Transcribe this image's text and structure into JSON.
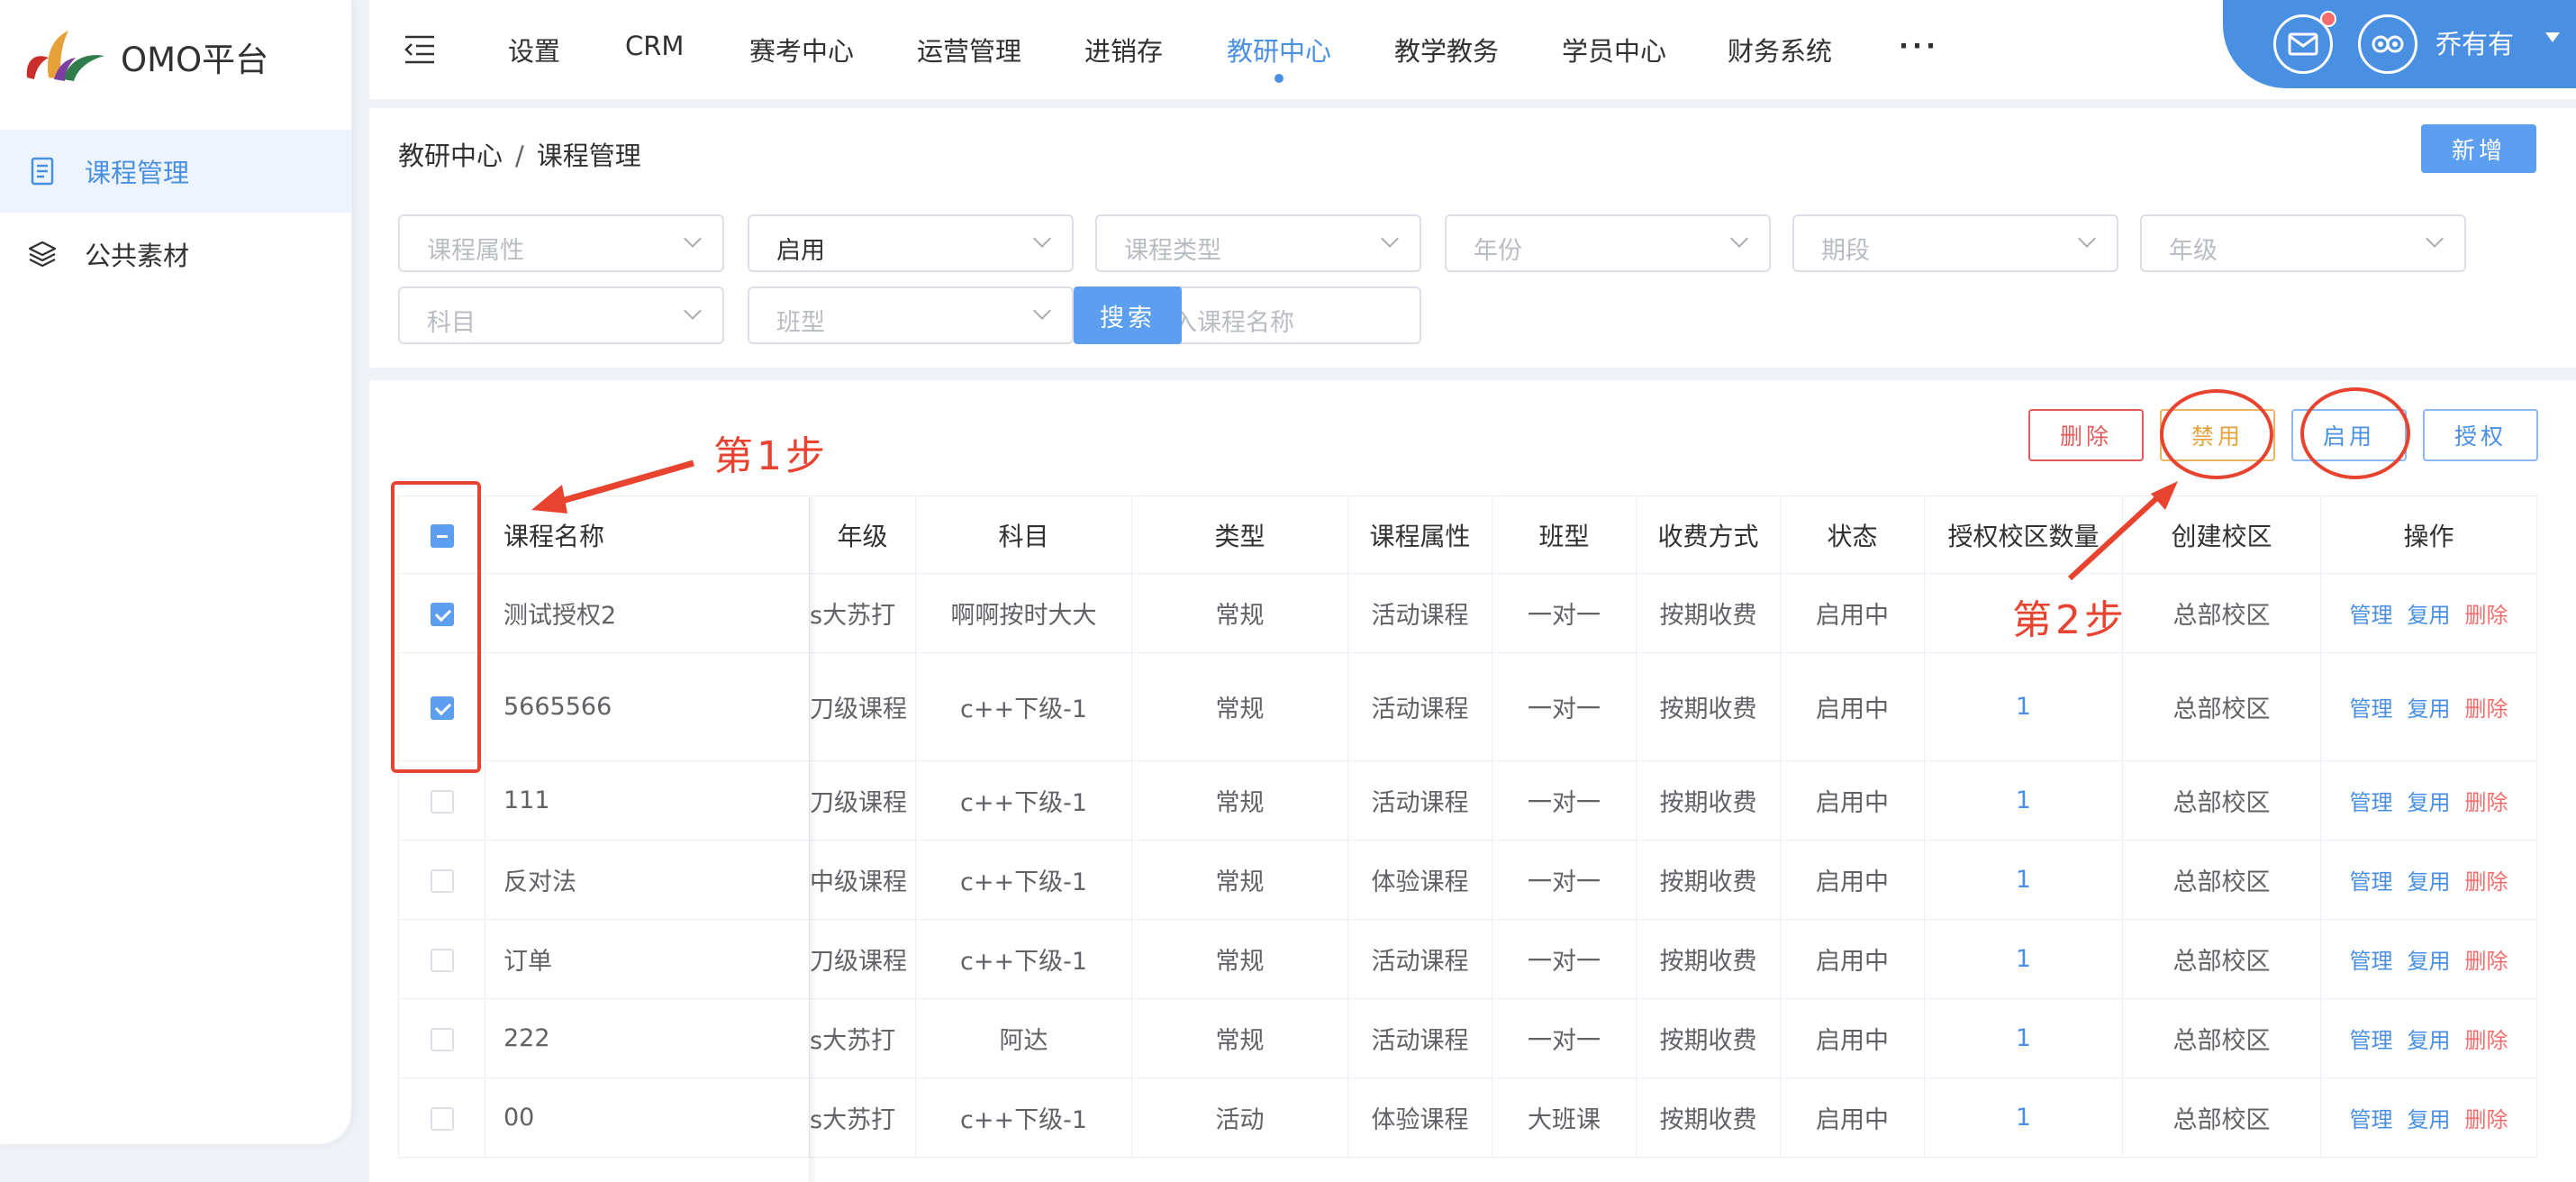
{
  "app": {
    "brand": "OMO平台"
  },
  "sidebar": {
    "items": [
      {
        "label": "课程管理",
        "icon": "document-icon",
        "active": true
      },
      {
        "label": "公共素材",
        "icon": "layers-icon",
        "active": false
      }
    ]
  },
  "topnav": {
    "items": [
      "设置",
      "CRM",
      "赛考中心",
      "运营管理",
      "进销存",
      "教研中心",
      "教学教务",
      "学员中心",
      "财务系统",
      "···"
    ],
    "active": "教研中心",
    "user": "乔有有"
  },
  "breadcrumb": {
    "parent": "教研中心",
    "sep": "/",
    "current": "课程管理"
  },
  "buttons": {
    "new": "新增",
    "search": "搜索",
    "delete": "删除",
    "disable": "禁用",
    "enable": "启用",
    "authorize": "授权"
  },
  "filters": {
    "course_attr": "课程属性",
    "status": "启用",
    "course_type": "课程类型",
    "year": "年份",
    "period": "期段",
    "grade": "年级",
    "subject": "科目",
    "class_type": "班型",
    "name_placeholder": "请输入课程名称"
  },
  "table": {
    "columns": [
      "课程名称",
      "年级",
      "科目",
      "类型",
      "课程属性",
      "班型",
      "收费方式",
      "状态",
      "授权校区数量",
      "创建校区",
      "操作"
    ],
    "ops": [
      "管理",
      "复用",
      "删除"
    ],
    "rows": [
      {
        "checked": true,
        "name": "测试授权2",
        "grade": "s大苏打",
        "subject": "啊啊按时大大",
        "type": "常规",
        "attr": "活动课程",
        "class_type": "一对一",
        "fee": "按期收费",
        "status": "启用中",
        "count": "",
        "campus": "总部校区"
      },
      {
        "checked": true,
        "name": "5665566",
        "grade": "刀级课程",
        "subject": "c++下级-1",
        "type": "常规",
        "attr": "活动课程",
        "class_type": "一对一",
        "fee": "按期收费",
        "status": "启用中",
        "count": "1",
        "campus": "总部校区"
      },
      {
        "checked": false,
        "name": "111",
        "grade": "刀级课程",
        "subject": "c++下级-1",
        "type": "常规",
        "attr": "活动课程",
        "class_type": "一对一",
        "fee": "按期收费",
        "status": "启用中",
        "count": "1",
        "campus": "总部校区"
      },
      {
        "checked": false,
        "name": "反对法",
        "grade": "中级课程",
        "subject": "c++下级-1",
        "type": "常规",
        "attr": "体验课程",
        "class_type": "一对一",
        "fee": "按期收费",
        "status": "启用中",
        "count": "1",
        "campus": "总部校区"
      },
      {
        "checked": false,
        "name": "订单",
        "grade": "刀级课程",
        "subject": "c++下级-1",
        "type": "常规",
        "attr": "活动课程",
        "class_type": "一对一",
        "fee": "按期收费",
        "status": "启用中",
        "count": "1",
        "campus": "总部校区"
      },
      {
        "checked": false,
        "name": "222",
        "grade": "s大苏打",
        "subject": "阿达",
        "type": "常规",
        "attr": "活动课程",
        "class_type": "一对一",
        "fee": "按期收费",
        "status": "启用中",
        "count": "1",
        "campus": "总部校区"
      },
      {
        "checked": false,
        "name": "00",
        "grade": "s大苏打",
        "subject": "c++下级-1",
        "type": "活动",
        "attr": "体验课程",
        "class_type": "大班课",
        "fee": "按期收费",
        "status": "启用中",
        "count": "1",
        "campus": "总部校区"
      }
    ]
  },
  "annotations": {
    "step1": "第1步",
    "step2": "第2步"
  },
  "colors": {
    "primary": "#4a90e2",
    "danger": "#f56c6c",
    "warning": "#e6a23c",
    "annotation": "#e8432f"
  }
}
